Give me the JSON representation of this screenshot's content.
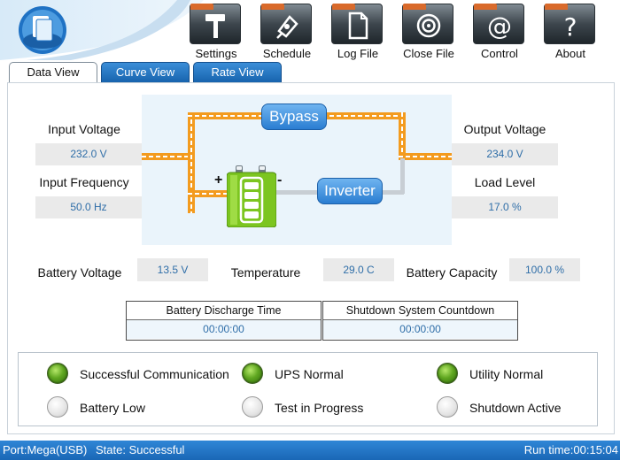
{
  "toolbar": {
    "buttons": [
      {
        "label": "Settings",
        "icon": "hammer-icon"
      },
      {
        "label": "Schedule",
        "icon": "schedule-icon"
      },
      {
        "label": "Log File",
        "icon": "document-icon"
      },
      {
        "label": "Close File",
        "icon": "target-icon"
      },
      {
        "label": "Control",
        "icon": "at-sign-icon"
      },
      {
        "label": "About",
        "icon": "question-icon"
      }
    ]
  },
  "tabs": [
    {
      "label": "Data View",
      "active": true
    },
    {
      "label": "Curve View",
      "active": false
    },
    {
      "label": "Rate View",
      "active": false
    }
  ],
  "input": {
    "voltage_label": "Input Voltage",
    "voltage_value": "232.0 V",
    "frequency_label": "Input Frequency",
    "frequency_value": "50.0 Hz"
  },
  "output": {
    "voltage_label": "Output Voltage",
    "voltage_value": "234.0 V",
    "load_label": "Load Level",
    "load_value": "17.0 %"
  },
  "diagram": {
    "bypass_label": "Bypass",
    "inverter_label": "Inverter",
    "plus": "+",
    "minus": "-"
  },
  "battery": {
    "voltage_label": "Battery Voltage",
    "voltage_value": "13.5 V",
    "temperature_label": "Temperature",
    "temperature_value": "29.0 C",
    "capacity_label": "Battery Capacity",
    "capacity_value": "100.0 %"
  },
  "timers": {
    "discharge_label": "Battery Discharge Time",
    "discharge_value": "00:00:00",
    "shutdown_label": "Shutdown System Countdown",
    "shutdown_value": "00:00:00"
  },
  "indicators": [
    {
      "label": "Successful Communication",
      "on": true
    },
    {
      "label": "UPS Normal",
      "on": true
    },
    {
      "label": "Utility Normal",
      "on": true
    },
    {
      "label": "Battery Low",
      "on": false
    },
    {
      "label": "Test in Progress",
      "on": false
    },
    {
      "label": "Shutdown Active",
      "on": false
    }
  ],
  "statusbar": {
    "port": "Port:Mega(USB)",
    "state": "State: Successful",
    "runtime": "Run time:00:15:04"
  },
  "colors": {
    "accent": "#1a67b6",
    "value_text": "#2f6ea8",
    "power_line": "#f39b1f",
    "battery": "#7cc520",
    "led_on": "#5fa620"
  }
}
